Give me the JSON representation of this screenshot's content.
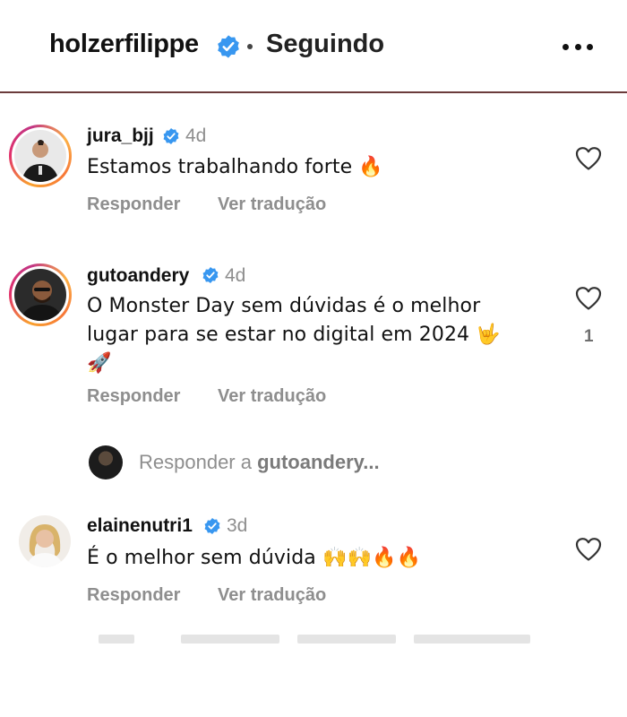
{
  "header": {
    "username": "holzerfilippe",
    "separator": "•",
    "status": "Seguindo",
    "more_icon": "more-horizontal-icon"
  },
  "colors": {
    "verified_blue": "#3897f0",
    "muted_text": "#8e8e8e",
    "divider": "#6b3b3b"
  },
  "comments": [
    {
      "username": "jura_bjj",
      "verified": true,
      "time": "4d",
      "text": "Estamos trabalhando forte 🔥",
      "reply_label": "Responder",
      "translate_label": "Ver tradução"
    },
    {
      "username": "gutoandery",
      "verified": true,
      "time": "4d",
      "text_line1": "O Monster Day sem dúvidas é o melhor",
      "text_line2": "lugar para se estar no digital em 2024 🤟",
      "text_line3": "🚀",
      "likes": "1",
      "reply_label": "Responder",
      "translate_label": "Ver tradução"
    },
    {
      "username": "elainenutri1",
      "verified": true,
      "time": "3d",
      "text": "É o melhor sem dúvida 🙌🙌🔥🔥",
      "reply_label": "Responder",
      "translate_label": "Ver tradução"
    }
  ],
  "reply_input": {
    "prefix": "Responder a ",
    "target": "gutoandery..."
  }
}
